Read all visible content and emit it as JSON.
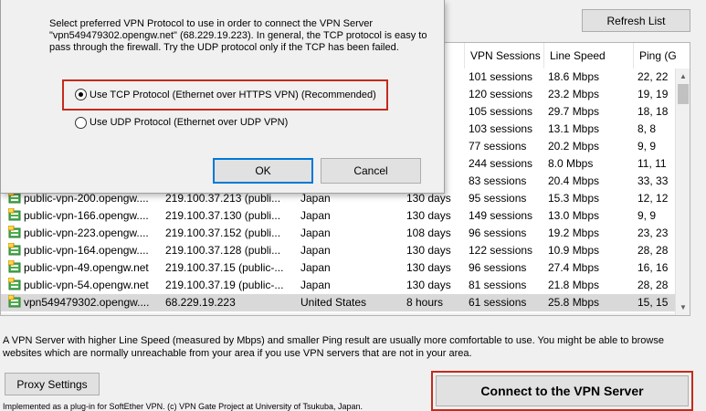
{
  "toolbar": {
    "refresh_label": "Refresh List"
  },
  "table": {
    "columns": [
      "VPN Sessions",
      "Line Speed",
      "Ping (G"
    ],
    "rows": [
      {
        "host": "",
        "ip": "",
        "country": "",
        "uptime": "",
        "sessions": "101 sessions",
        "speed": "18.6 Mbps",
        "ping": "22, 22"
      },
      {
        "host": "",
        "ip": "",
        "country": "",
        "uptime": "",
        "sessions": "120 sessions",
        "speed": "23.2 Mbps",
        "ping": "19, 19"
      },
      {
        "host": "",
        "ip": "",
        "country": "",
        "uptime": "",
        "sessions": "105 sessions",
        "speed": "29.7 Mbps",
        "ping": "18, 18"
      },
      {
        "host": "",
        "ip": "",
        "country": "",
        "uptime": "",
        "sessions": "103 sessions",
        "speed": "13.1 Mbps",
        "ping": "8, 8"
      },
      {
        "host": "",
        "ip": "",
        "country": "",
        "uptime": "",
        "sessions": "77 sessions",
        "speed": "20.2 Mbps",
        "ping": "9, 9"
      },
      {
        "host": "",
        "ip": "",
        "country": "",
        "uptime": "",
        "sessions": "244 sessions",
        "speed": "8.0 Mbps",
        "ping": "11, 11"
      },
      {
        "host": "",
        "ip": "",
        "country": "",
        "uptime": "",
        "sessions": "83 sessions",
        "speed": "20.4 Mbps",
        "ping": "33, 33"
      },
      {
        "host": "public-vpn-200.opengw....",
        "ip": "219.100.37.213 (publi...",
        "country": "Japan",
        "uptime": "130 days",
        "sessions": "95 sessions",
        "speed": "15.3 Mbps",
        "ping": "12, 12"
      },
      {
        "host": "public-vpn-166.opengw....",
        "ip": "219.100.37.130 (publi...",
        "country": "Japan",
        "uptime": "130 days",
        "sessions": "149 sessions",
        "speed": "13.0 Mbps",
        "ping": "9, 9"
      },
      {
        "host": "public-vpn-223.opengw....",
        "ip": "219.100.37.152 (publi...",
        "country": "Japan",
        "uptime": "108 days",
        "sessions": "96 sessions",
        "speed": "19.2 Mbps",
        "ping": "23, 23"
      },
      {
        "host": "public-vpn-164.opengw....",
        "ip": "219.100.37.128 (publi...",
        "country": "Japan",
        "uptime": "130 days",
        "sessions": "122 sessions",
        "speed": "10.9 Mbps",
        "ping": "28, 28"
      },
      {
        "host": "public-vpn-49.opengw.net",
        "ip": "219.100.37.15 (public-...",
        "country": "Japan",
        "uptime": "130 days",
        "sessions": "96 sessions",
        "speed": "27.4 Mbps",
        "ping": "16, 16"
      },
      {
        "host": "public-vpn-54.opengw.net",
        "ip": "219.100.37.19 (public-...",
        "country": "Japan",
        "uptime": "130 days",
        "sessions": "81 sessions",
        "speed": "21.8 Mbps",
        "ping": "28, 28"
      },
      {
        "host": "vpn549479302.opengw....",
        "ip": "68.229.19.223",
        "country": "United States",
        "uptime": "8 hours",
        "sessions": "61 sessions",
        "speed": "25.8 Mbps",
        "ping": "15, 15"
      }
    ]
  },
  "info": {
    "line1": "A VPN Server with higher Line Speed (measured by Mbps) and smaller Ping result are usually more comfortable to use. You might be able to browse",
    "line2": "websites which are normally unreachable from your area if you use VPN servers that are not in your area."
  },
  "proxy_label": "Proxy Settings",
  "connect_label": "Connect to the VPN Server",
  "footer": "Implemented as a plug-in for SoftEther VPN. (c) VPN Gate Project at University of Tsukuba, Japan.",
  "dialog": {
    "msg1": "Select preferred VPN Protocol to use in order to connect the VPN Server",
    "msg2": "\"vpn549479302.opengw.net\" (68.229.19.223). In general, the TCP protocol is easy to",
    "msg3": "pass through the firewall. Try the UDP protocol only if the TCP has been failed.",
    "tcp_label": "Use TCP Protocol (Ethernet over HTTPS VPN) (Recommended)",
    "udp_label": "Use UDP Protocol (Ethernet over UDP VPN)",
    "tcp_selected": true,
    "ok_label": "OK",
    "cancel_label": "Cancel"
  },
  "colors": {
    "highlight_border": "#c42b1c",
    "ok_border": "#0078d7",
    "selected_row": "#d9d9d9",
    "icon_green": "#4caf50"
  }
}
